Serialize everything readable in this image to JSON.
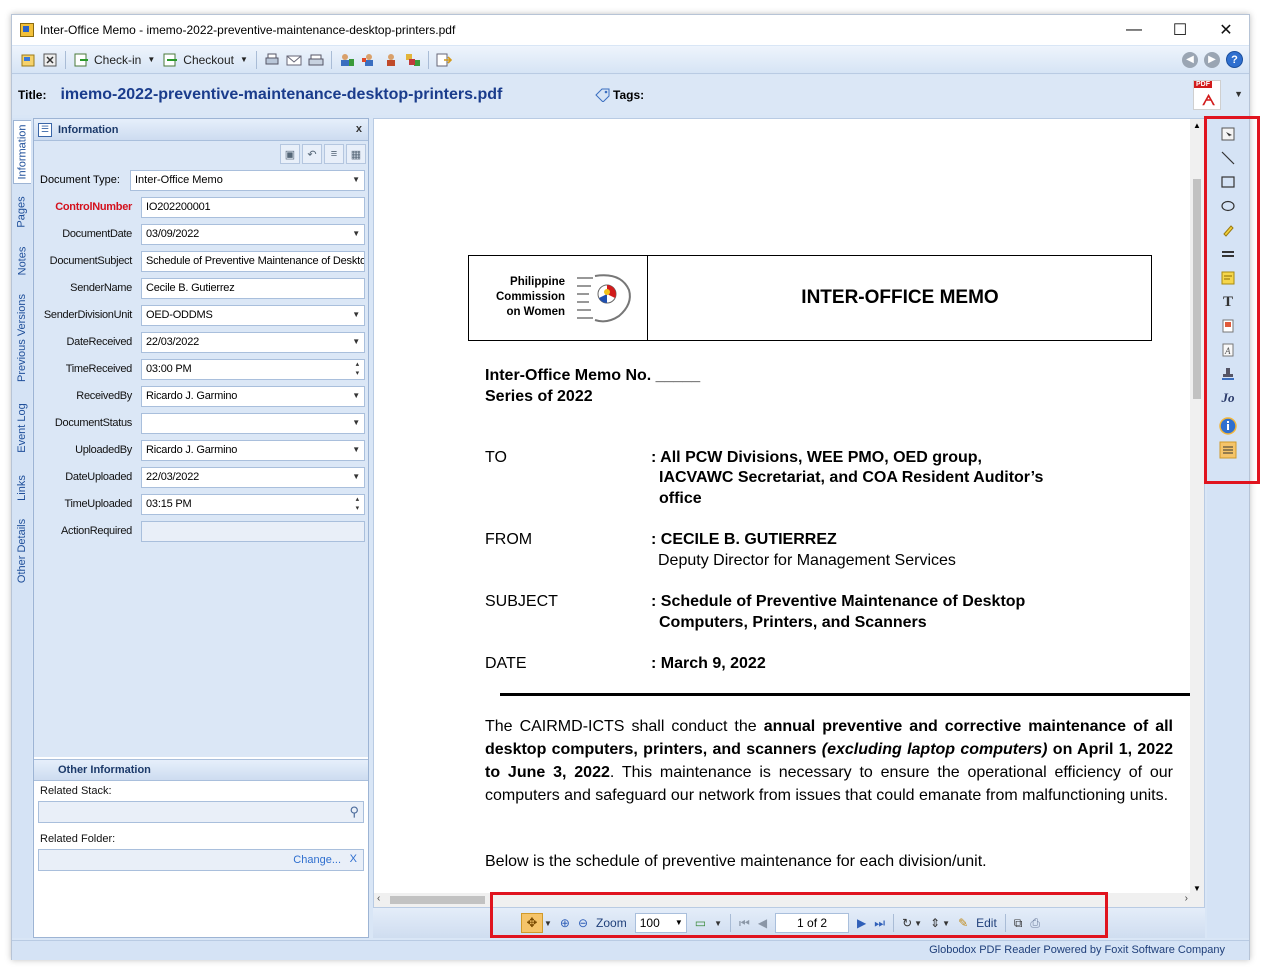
{
  "window": {
    "title": "Inter-Office Memo - imemo-2022-preventive-maintenance-desktop-printers.pdf",
    "minimize": "—",
    "maximize": "☐",
    "close": "✕"
  },
  "toolbar": {
    "checkin_label": "Check-in",
    "checkout_label": "Checkout"
  },
  "title_row": {
    "label": "Title:",
    "value": "imemo-2022-preventive-maintenance-desktop-printers.pdf",
    "tags_label": "Tags:",
    "pdf_badge": "PDF"
  },
  "vtabs": [
    "Information",
    "Pages",
    "Notes",
    "Previous Versions",
    "Event Log",
    "Links",
    "Other Details"
  ],
  "info_panel": {
    "title": "Information",
    "close": "x",
    "doc_type_label": "Document Type:",
    "doc_type_value": "Inter-Office Memo",
    "fields": [
      {
        "label": "ControlNumber",
        "value": "IO202200001"
      },
      {
        "label": "DocumentDate",
        "value": "03/09/2022"
      },
      {
        "label": "DocumentSubject",
        "value": "Schedule of Preventive Maintenance of Desktop"
      },
      {
        "label": "SenderName",
        "value": "Cecile B. Gutierrez"
      },
      {
        "label": "SenderDivisionUnit",
        "value": "OED-ODDMS"
      },
      {
        "label": "DateReceived",
        "value": "22/03/2022"
      },
      {
        "label": "TimeReceived",
        "value": "03:00 PM"
      },
      {
        "label": "ReceivedBy",
        "value": "Ricardo J. Garmino"
      },
      {
        "label": "DocumentStatus",
        "value": ""
      },
      {
        "label": "UploadedBy",
        "value": "Ricardo J. Garmino"
      },
      {
        "label": "DateUploaded",
        "value": "22/03/2022"
      },
      {
        "label": "TimeUploaded",
        "value": "03:15 PM"
      },
      {
        "label": "ActionRequired",
        "value": ""
      }
    ],
    "other_info_title": "Other Information",
    "related_stack_label": "Related Stack:",
    "related_folder_label": "Related Folder:",
    "change_link": "Change...",
    "clear_link": "X"
  },
  "memo": {
    "logo_text": "Philippine Commission on Women",
    "heading": "INTER-OFFICE MEMO",
    "memo_no": "Inter-Office Memo No. _____",
    "series": "Series of 2022",
    "to_label": "TO",
    "to_line1": ": All PCW Divisions, WEE PMO, OED group,",
    "to_line2": "IACVAWC Secretariat, and COA Resident Auditor’s",
    "to_line3": "office",
    "from_label": "FROM",
    "from_line1": ": CECILE B. GUTIERREZ",
    "from_line2": "Deputy Director for Management Services",
    "subject_label": "SUBJECT",
    "subject_line1": ": Schedule of Preventive Maintenance of Desktop",
    "subject_line2": "Computers,  Printers, and Scanners",
    "date_label": "DATE",
    "date_value": ": March 9, 2022",
    "para1_a": "The CAIRMD-ICTS shall conduct the ",
    "para1_b": "annual preventive and corrective maintenance of all desktop computers, printers, and scanners ",
    "para1_c": "(excluding laptop computers)",
    "para1_d": " on April 1, 2022 to June 3, 2022",
    "para1_e": ". This maintenance is necessary to ensure the operational efficiency of our computers and safeguard our network from issues that could emanate from malfunctioning units.",
    "para2": "Below is the schedule of preventive maintenance for each division/unit."
  },
  "viewer_bar": {
    "zoom_label": "Zoom",
    "zoom_value": "100",
    "page_value": "1 of 2",
    "edit_label": "Edit"
  },
  "status": {
    "text": "Globodox PDF Reader Powered by Foxit Software Company"
  },
  "colors": {
    "highlight": "#e0141f",
    "required_label": "#d4121e",
    "title_blue": "#1a3c8c"
  }
}
